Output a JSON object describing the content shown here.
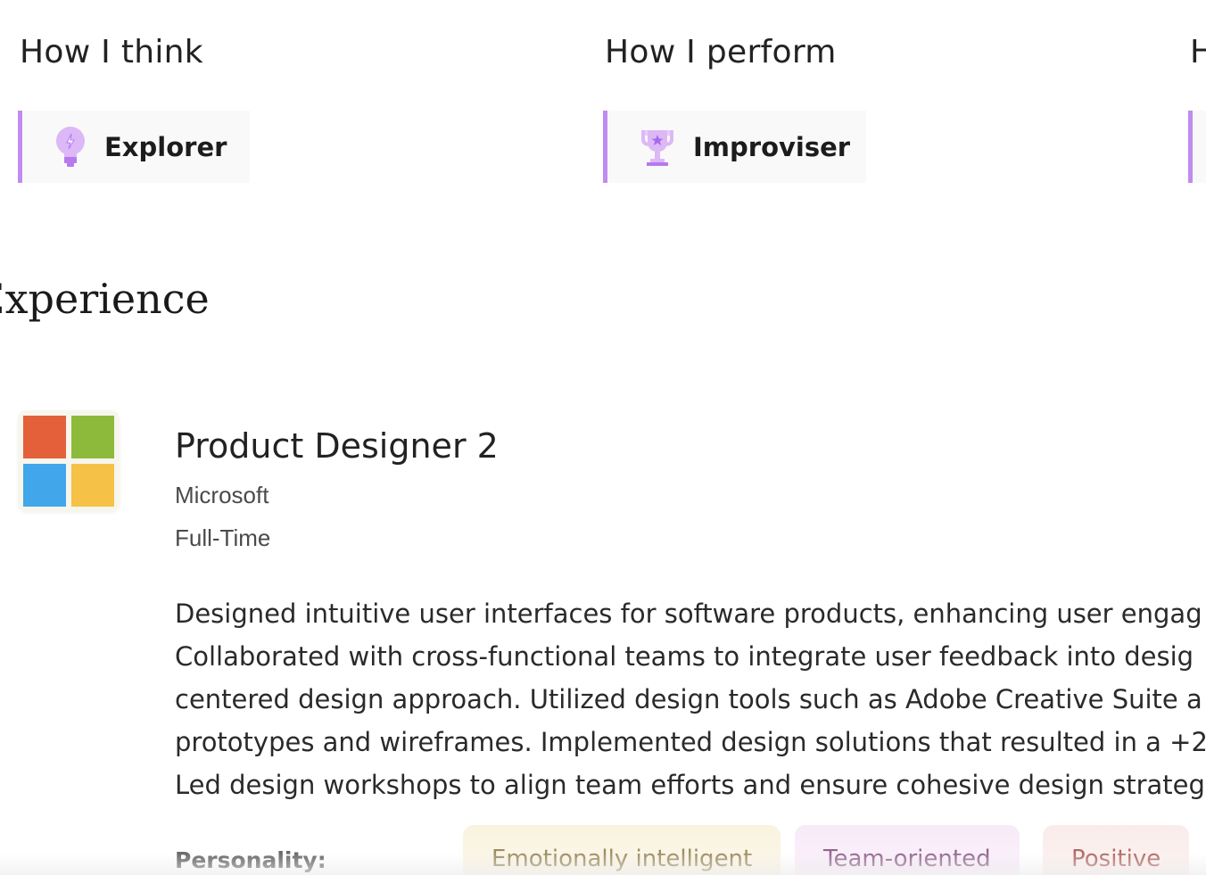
{
  "traits": [
    {
      "heading": "How I think",
      "chip_label": "Explorer",
      "icon": "lightbulb-icon"
    },
    {
      "heading": "How I perform",
      "chip_label": "Improviser",
      "icon": "trophy-icon"
    },
    {
      "heading": "H",
      "chip_label": "",
      "icon": ""
    }
  ],
  "colors": {
    "accent": "#c08cf0",
    "icon_fill": "#dcb8f7",
    "icon_stroke": "#b679ee"
  },
  "experience": {
    "section_title": "Experience",
    "job": {
      "logo": "microsoft-logo",
      "logo_colors": [
        "#e4603a",
        "#8dba3a",
        "#42a6ea",
        "#f5c146"
      ],
      "title": "Product Designer 2",
      "company": "Microsoft",
      "employment_type": "Full-Time",
      "description_lines": [
        "Designed intuitive user interfaces for software products, enhancing user engag",
        "Collaborated with cross-functional teams to integrate user feedback into desig",
        "centered design approach. Utilized design tools such as Adobe Creative Suite a",
        "prototypes and wireframes. Implemented design solutions that resulted in a +2",
        "Led design workshops to align team efforts and ensure cohesive design strateg"
      ],
      "personality_label": "Personality:",
      "personality_tags": [
        {
          "label": "Emotionally intelligent",
          "bg": "#f8f0d8",
          "fg": "#6b5412"
        },
        {
          "label": "Team-oriented",
          "bg": "#f6e6f6",
          "fg": "#5e1a5a"
        },
        {
          "label": "Positive",
          "bg": "#f9e8e6",
          "fg": "#8a1e16"
        }
      ]
    }
  }
}
